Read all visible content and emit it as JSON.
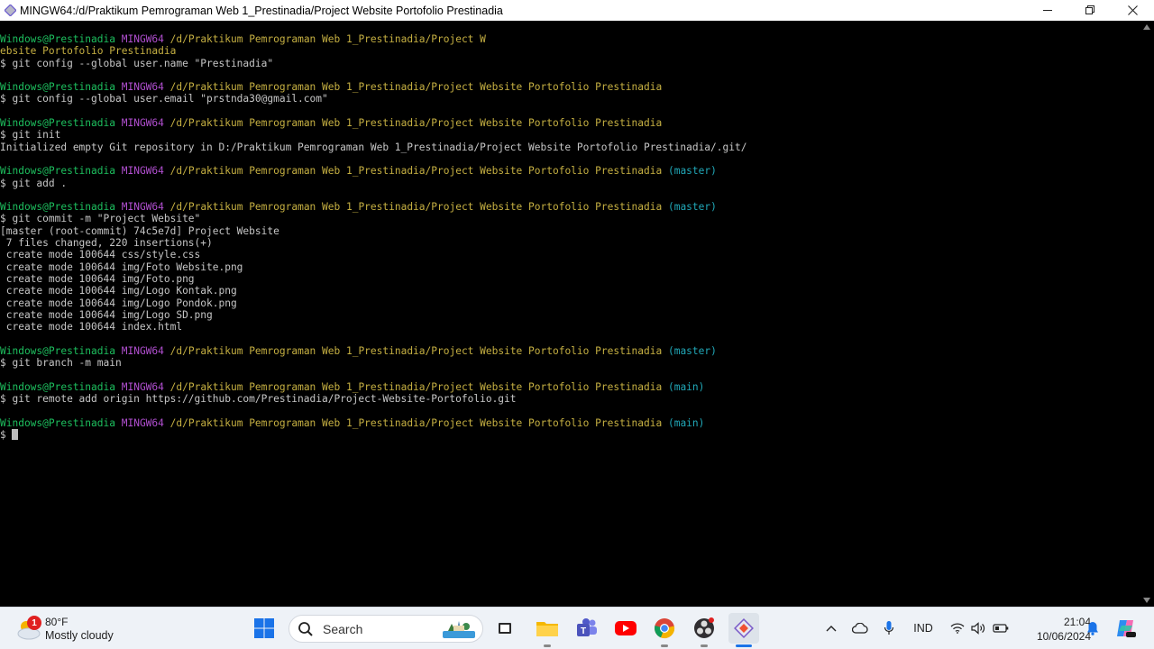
{
  "window": {
    "title": "MINGW64:/d/Praktikum Pemrograman Web 1_Prestinadia/Project Website Portofolio Prestinadia"
  },
  "terminal": {
    "user": "Windows@Prestinadia",
    "env": "MINGW64",
    "path_wrapped_1": "/d/Praktikum Pemrograman Web 1_Prestinadia/Project W",
    "path_wrapped_2": "ebsite Portofolio Prestinadia",
    "path": "/d/Praktikum Pemrograman Web 1_Prestinadia/Project Website Portofolio Prestinadia",
    "branch_master": "(master)",
    "branch_main": "(main)",
    "commands": {
      "c1": "$ git config --global user.name \"Prestinadia\"",
      "c2": "$ git config --global user.email \"prstnda30@gmail.com\"",
      "c3": "$ git init",
      "c4": "$ git add .",
      "c5": "$ git commit -m \"Project Website\"",
      "c6": "$ git branch -m main",
      "c7": "$ git remote add origin https://github.com/Prestinadia/Project-Website-Portofolio.git",
      "prompt": "$ "
    },
    "outputs": {
      "init": "Initialized empty Git repository in D:/Praktikum Pemrograman Web 1_Prestinadia/Project Website Portofolio Prestinadia/.git/",
      "commit_head": "[master (root-commit) 74c5e7d] Project Website",
      "commit_stats": " 7 files changed, 220 insertions(+)",
      "create": [
        " create mode 100644 css/style.css",
        " create mode 100644 img/Foto Website.png",
        " create mode 100644 img/Foto.png",
        " create mode 100644 img/Logo Kontak.png",
        " create mode 100644 img/Logo Pondok.png",
        " create mode 100644 img/Logo SD.png",
        " create mode 100644 index.html"
      ]
    }
  },
  "taskbar": {
    "weather": {
      "temp": "80°F",
      "desc": "Mostly cloudy",
      "badge": "1"
    },
    "search": {
      "placeholder": "Search"
    },
    "tray": {
      "language": "IND"
    },
    "clock": {
      "time": "21:04",
      "date": "10/06/2024"
    }
  },
  "colors": {
    "user": "#1dbf5e",
    "env": "#b14fd0",
    "path": "#c6b042",
    "branch": "#21a8b8"
  }
}
